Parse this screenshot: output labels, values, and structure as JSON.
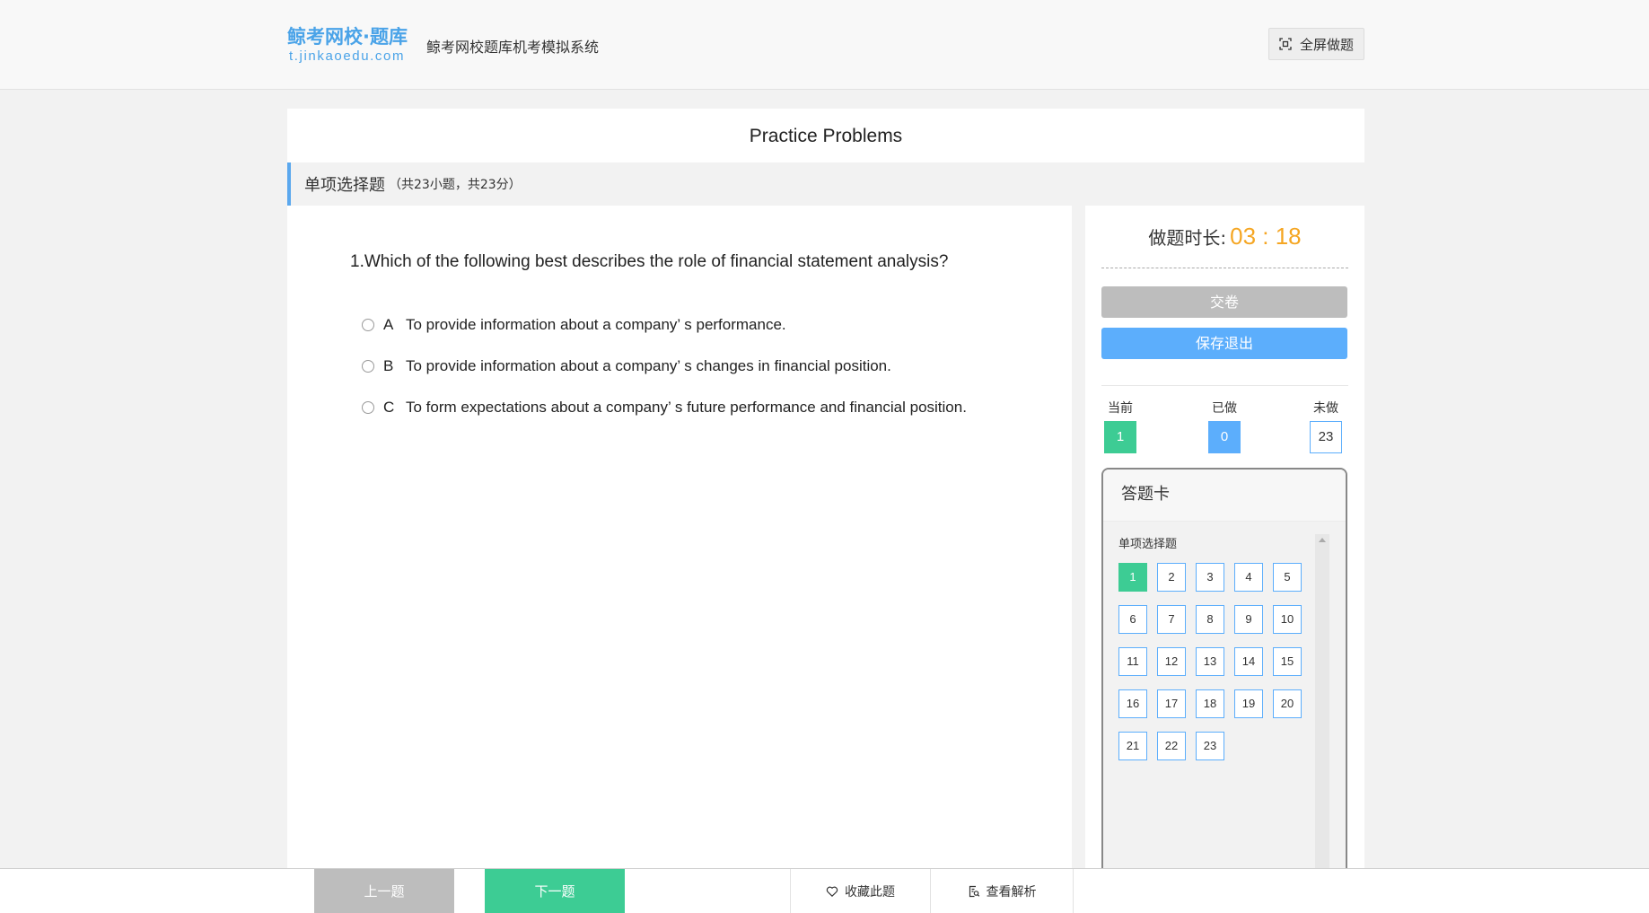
{
  "header": {
    "logo_main": "鲸考网校·题库",
    "logo_sub": "t.jinkaoedu.com",
    "system_title": "鲸考网校题库机考模拟系统",
    "fullscreen_label": "全屏做题",
    "fullscreen_icon": "fullscreen-icon"
  },
  "paper_title": "Practice Problems",
  "section": {
    "name": "单项选择题",
    "info": "（共23小题，共23分）"
  },
  "question": {
    "text": "1.Which of the following best describes the role of financial statement analysis?",
    "options": [
      {
        "letter": "A",
        "text": "To provide information about a company’ s performance."
      },
      {
        "letter": "B",
        "text": "To provide information about a company’ s changes in financial position."
      },
      {
        "letter": "C",
        "text": "To form expectations about a company’ s future performance and financial position."
      }
    ]
  },
  "timer": {
    "label": "做题时长:",
    "value": "03 : 18"
  },
  "buttons": {
    "submit": "交卷",
    "save_exit": "保存退出"
  },
  "stats": {
    "current_label": "当前",
    "current_value": "1",
    "done_label": "已做",
    "done_value": "0",
    "todo_label": "未做",
    "todo_value": "23"
  },
  "answer_card": {
    "title": "答题卡",
    "section_name": "单项选择题",
    "current": 1,
    "numbers": [
      "1",
      "2",
      "3",
      "4",
      "5",
      "6",
      "7",
      "8",
      "9",
      "10",
      "11",
      "12",
      "13",
      "14",
      "15",
      "16",
      "17",
      "18",
      "19",
      "20",
      "21",
      "22",
      "23"
    ]
  },
  "bottom": {
    "prev": "上一题",
    "next": "下一题",
    "favorite": "收藏此题",
    "analysis": "查看解析"
  },
  "colors": {
    "accent_blue": "#5caefc",
    "accent_green": "#3dcc94",
    "timer_orange": "#f5a623",
    "disabled_gray": "#bdbdbd"
  }
}
